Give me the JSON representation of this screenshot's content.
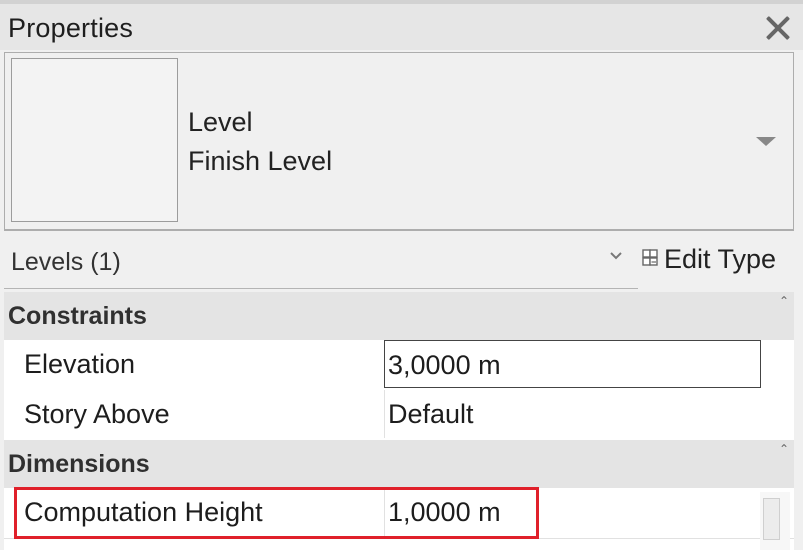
{
  "palette": {
    "panel_background": "#f0f0f0",
    "section_background": "#e4e4e4",
    "highlight": "#e0202a"
  },
  "panel": {
    "title": "Properties",
    "close_icon": "close-icon"
  },
  "type_selector": {
    "family": "Level",
    "type_name": "Finish Level",
    "dropdown_icon": "triangle-down-icon"
  },
  "filter": {
    "label": "Levels (1)",
    "chevron_icon": "chevron-down-icon",
    "edit_type_label": "Edit Type",
    "edit_type_icon": "edit-type-icon"
  },
  "sections": [
    {
      "title": "Constraints",
      "rows": [
        {
          "label": "Elevation",
          "value": "3,0000 m",
          "editing": true
        },
        {
          "label": "Story Above",
          "value": "Default",
          "editing": false
        }
      ]
    },
    {
      "title": "Dimensions",
      "rows": [
        {
          "label": "Computation Height",
          "value": "1,0000 m",
          "highlighted": true
        }
      ]
    }
  ]
}
